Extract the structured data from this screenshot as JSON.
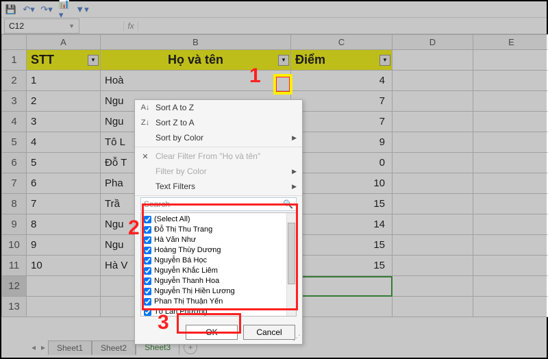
{
  "qat": {
    "tips": [
      "save",
      "undo",
      "redo",
      "chart",
      "filter"
    ]
  },
  "namebox": "C12",
  "columns": [
    "A",
    "B",
    "C",
    "D",
    "E"
  ],
  "headers": {
    "stt": "STT",
    "name": "Họ và tên",
    "score": "Điểm"
  },
  "rows": [
    {
      "r": "1",
      "stt": "STT",
      "name": "",
      "score": ""
    },
    {
      "r": "2",
      "stt": "1",
      "name": "Hoà",
      "score": "4"
    },
    {
      "r": "3",
      "stt": "2",
      "name": "Ngu",
      "score": "7"
    },
    {
      "r": "4",
      "stt": "3",
      "name": "Ngu",
      "score": "7"
    },
    {
      "r": "5",
      "stt": "4",
      "name": "Tô L",
      "score": "9"
    },
    {
      "r": "6",
      "stt": "5",
      "name": "Đỗ T",
      "score": "0"
    },
    {
      "r": "7",
      "stt": "6",
      "name": "Pha",
      "score": "10"
    },
    {
      "r": "8",
      "stt": "7",
      "name": "Trầ",
      "score": "15"
    },
    {
      "r": "9",
      "stt": "8",
      "name": "Ngu",
      "score": "14"
    },
    {
      "r": "10",
      "stt": "9",
      "name": "Ngu",
      "score": "15"
    },
    {
      "r": "11",
      "stt": "10",
      "name": "Hà V",
      "score": "15"
    }
  ],
  "extraRows": [
    "12",
    "13"
  ],
  "dropdown": {
    "sortAZ": "Sort A to Z",
    "sortZA": "Sort Z to A",
    "sortColor": "Sort by Color",
    "clear": "Clear Filter From \"Họ và tên\"",
    "filterColor": "Filter by Color",
    "textFilters": "Text Filters",
    "searchPlaceholder": "Search",
    "items": [
      "(Select All)",
      "Đỗ Thị Thu Trang",
      "Hà Văn Như",
      "Hoàng Thùy Dương",
      "Nguyễn Bá Học",
      "Nguyễn Khắc Liêm",
      "Nguyễn Thanh Hoa",
      "Nguyễn Thị Hiền Lương",
      "Phan Thị Thuận Yến",
      "Tô Lan Phương"
    ],
    "ok": "OK",
    "cancel": "Cancel"
  },
  "tabs": {
    "t1": "Sheet1",
    "t2": "Sheet2",
    "t3": "Sheet3"
  },
  "ann": {
    "a1": "1",
    "a2": "2",
    "a3": "3"
  }
}
